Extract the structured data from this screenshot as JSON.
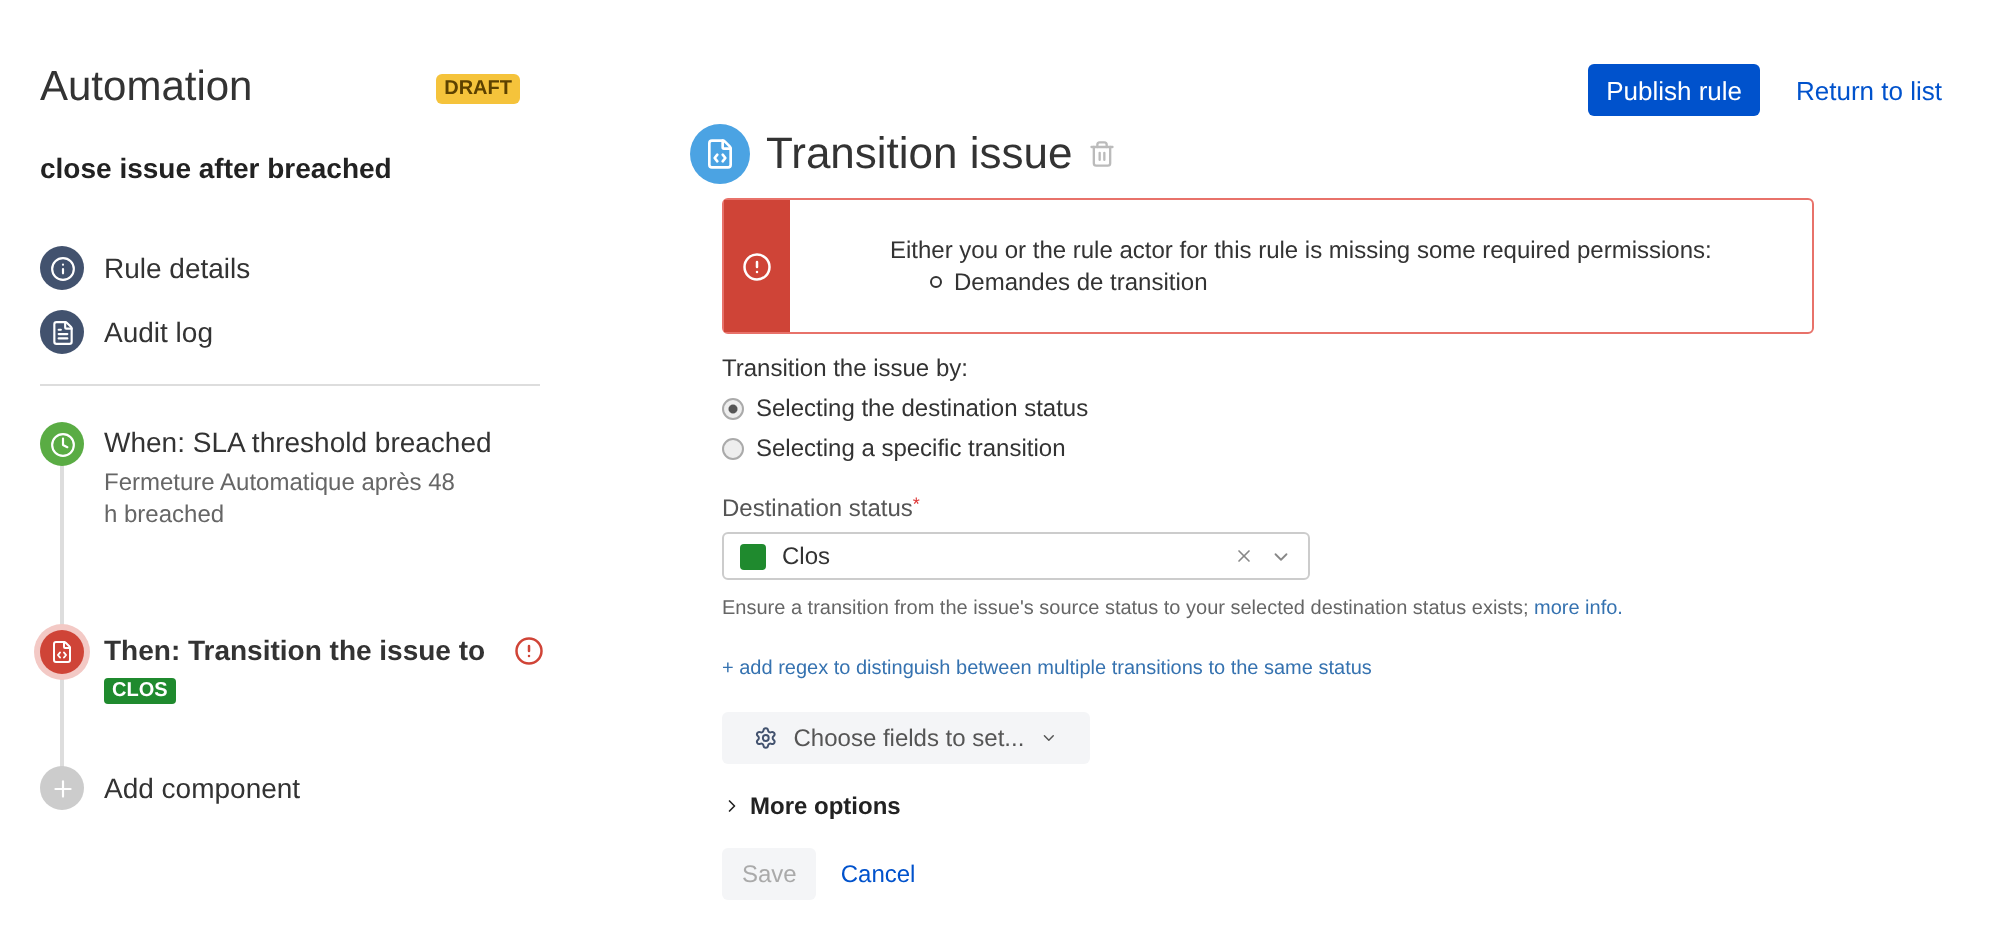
{
  "header": {
    "title": "Automation",
    "status_badge": "DRAFT"
  },
  "rule_name": "close issue after breached",
  "nav": [
    {
      "kind": "info",
      "label": "Rule details"
    },
    {
      "kind": "log",
      "label": "Audit log"
    }
  ],
  "components": [
    {
      "kind": "trigger",
      "title": "When: SLA threshold breached",
      "description": "Fermeture Automatique après 48 h breached"
    },
    {
      "kind": "action",
      "title": "Then: Transition the issue to",
      "badge": "CLOS",
      "error": true,
      "selected": true
    },
    {
      "kind": "add",
      "title": "Add component"
    }
  ],
  "top_actions": {
    "publish": "Publish rule",
    "return": "Return to list"
  },
  "editor": {
    "title": "Transition issue",
    "alert": {
      "message": "Either you or the rule actor for this rule is missing some required permissions:",
      "items": [
        "Demandes de transition"
      ]
    },
    "transition_by": {
      "label": "Transition the issue by:",
      "options": [
        {
          "label": "Selecting the destination status",
          "selected": true
        },
        {
          "label": "Selecting a specific transition",
          "selected": false
        }
      ]
    },
    "destination": {
      "label": "Destination status",
      "required_mark": "*",
      "value": "Clos",
      "color": "#1f8a2e",
      "hint": "Ensure a transition from the issue's source status to your selected destination status exists;",
      "hint_link": "more info."
    },
    "regex_link": "+ add regex to distinguish between multiple transitions to the same status",
    "choose_fields": "Choose fields to set...",
    "more_options": {
      "label": "More options",
      "expanded": false
    },
    "save": {
      "label": "Save",
      "disabled": true
    },
    "cancel": "Cancel"
  }
}
